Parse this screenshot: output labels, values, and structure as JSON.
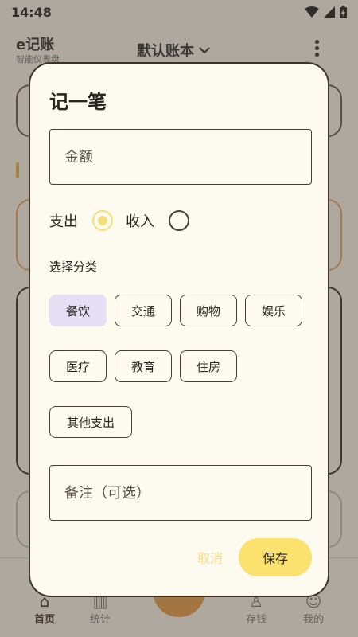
{
  "status_bar": {
    "time": "14:48"
  },
  "app_header": {
    "logo": "e记账",
    "slogan": "智能仪表盘",
    "book_selector": "默认账本"
  },
  "bottom_nav": {
    "items": [
      "首页",
      "统计",
      "存钱",
      "我的"
    ]
  },
  "dialog": {
    "title": "记一笔",
    "amount_placeholder": "金额",
    "type_options": {
      "expense": "支出",
      "income": "收入",
      "selected": "expense"
    },
    "category_title": "选择分类",
    "categories": [
      "餐饮",
      "交通",
      "购物",
      "娱乐",
      "医疗",
      "教育",
      "住房",
      "其他支出"
    ],
    "selected_category": "餐饮",
    "note_placeholder": "备注（可选）",
    "cancel_label": "取消",
    "save_label": "保存"
  },
  "colors": {
    "accent_yellow": "#fbe16e",
    "selected_chip": "#e7dff5",
    "border": "#4a4038",
    "dialog_bg": "#fdfaf0"
  }
}
